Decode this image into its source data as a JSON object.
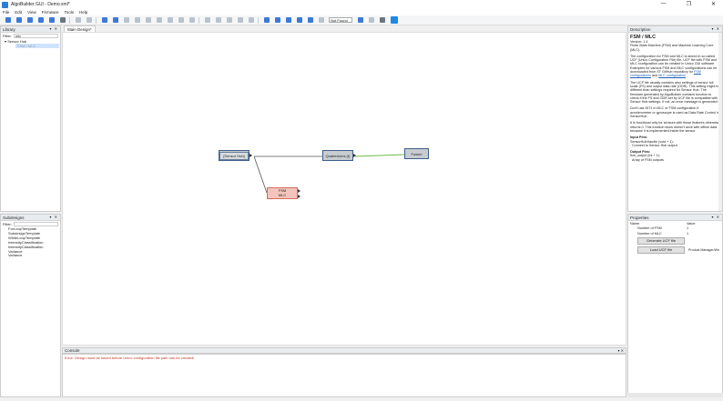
{
  "window": {
    "title": "AlgoBuilder GUI - Demo.xml*",
    "controls": [
      "—",
      "❐",
      "✕"
    ]
  },
  "menu": [
    "File",
    "Edit",
    "View",
    "Firmware",
    "Tools",
    "Help"
  ],
  "toolbar": {
    "combo_value": "Not Found"
  },
  "library": {
    "title": "Library",
    "filter_label": "Filter:",
    "filter_value": "mlc",
    "tree_root": "Sensor Hub",
    "tree_child": "FSM / MLC"
  },
  "subdesigns": {
    "title": "Subdesigns",
    "filter_label": "Filter:",
    "items": [
      "ForLoopTemplate",
      "SubdesignTemplate",
      "WhileLoopTemplate",
      "IntensityClassification",
      "IntensityClassification",
      "Variance",
      "Variance"
    ]
  },
  "tab": {
    "label": "Main Design*"
  },
  "canvas": {
    "nodes": {
      "sensor_hub": "[Sensor Hub]",
      "quaternions": "Quaternions (f)",
      "fusion": "Fusion",
      "fsm_line1": "FSM",
      "fsm_line2": "MLC"
    }
  },
  "console": {
    "title": "Console",
    "message": "Error: Design must be saved before Unico configuration file path can be created!"
  },
  "description": {
    "title": "Description",
    "heading": "FSM / MLC",
    "version": "Version: 1.4",
    "subtitle": "Finite State Machine (FSM) and Machine Learning Core (MLC).",
    "p1_a": "The configuration for FSM and MLC is stored in so called UCF (Unico Configuration File) file. UCF file with FSM and MLC configuration can be created in Unico GUI software. Examples for various FSM and MLC configurations can be downloaded from ST GitHub repository for ",
    "p1_link1": "FSM configurations",
    "p1_and": " and ",
    "p1_link2": "MLC configuration",
    "p1_end": ".",
    "p2": "The UCF file usually contains also settings of sensor full scale (FS) and output data rate (ODR). This setting might be different than settings required for Sensor Hub. The firmware generated by AlgoBuilder contains function to check if the FS and ODR set by UCF file is compatible with Sensor Hub settings. If not, an error message is generated.",
    "p3": "Don't use INT1 in MLC or FSM configuration if accelerometer or gyroscope is used as Data Rate Control in SensorHub.",
    "p4": "It is functional only for sensors with these features otherwise returns 0. This function block doesn't work with offline data because it is implemented inside the sensor.",
    "input_title": "Input Pins:",
    "input_1": "SensorHubHandle (void + 1):",
    "input_2": "Connect to Sensor Hub output.",
    "output_title": "Output Pins:",
    "output_1": "fsm_output (int + 1):",
    "output_2": "Array of FSM outputs"
  },
  "properties": {
    "title": "Properties",
    "col_name": "Name",
    "col_value": "Value",
    "row1_name": "Number of FSM",
    "row1_value": "1",
    "row2_name": "Number of MLC",
    "row2_value": "1",
    "gen_button": "Generate UCF file",
    "load_button": "Load UCF file",
    "load_value": "Product Manager/Wo"
  }
}
